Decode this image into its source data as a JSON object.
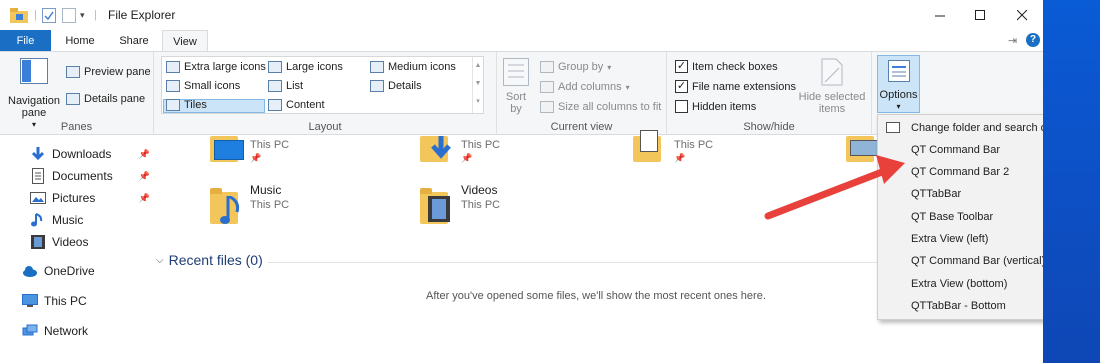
{
  "window": {
    "title": "File Explorer"
  },
  "tabs": [
    {
      "label": "File"
    },
    {
      "label": "Home"
    },
    {
      "label": "Share"
    },
    {
      "label": "View"
    }
  ],
  "ribbon": {
    "panes": {
      "label": "Panes",
      "navigation_pane": "Navigation pane",
      "preview_pane": "Preview pane",
      "details_pane": "Details pane"
    },
    "layout": {
      "label": "Layout",
      "options": [
        {
          "label": "Extra large icons"
        },
        {
          "label": "Large icons"
        },
        {
          "label": "Medium icons"
        },
        {
          "label": "Small icons"
        },
        {
          "label": "List"
        },
        {
          "label": "Details"
        },
        {
          "label": "Tiles",
          "selected": true
        },
        {
          "label": "Content"
        }
      ]
    },
    "current_view": {
      "label": "Current view",
      "sort_by": "Sort by",
      "group_by": "Group by",
      "add_columns": "Add columns",
      "size_all_columns": "Size all columns to fit"
    },
    "show_hide": {
      "label": "Show/hide",
      "item_check_boxes": {
        "label": "Item check boxes",
        "checked": true
      },
      "file_name_extensions": {
        "label": "File name extensions",
        "checked": true
      },
      "hidden_items": {
        "label": "Hidden items",
        "checked": false
      },
      "hide_selected_items": "Hide selected items"
    },
    "options": {
      "label": "Options"
    }
  },
  "nav": {
    "items": [
      {
        "label": "Downloads",
        "icon": "download-arrow-icon",
        "pinned": true
      },
      {
        "label": "Documents",
        "icon": "document-icon",
        "pinned": true
      },
      {
        "label": "Pictures",
        "icon": "picture-icon",
        "pinned": true
      },
      {
        "label": "Music",
        "icon": "music-note-icon",
        "pinned": false
      },
      {
        "label": "Videos",
        "icon": "video-icon",
        "pinned": false
      },
      {
        "label": "OneDrive",
        "icon": "cloud-icon",
        "pinned": false
      },
      {
        "label": "This PC",
        "icon": "monitor-icon",
        "pinned": false
      },
      {
        "label": "Network",
        "icon": "network-icon",
        "pinned": false
      }
    ]
  },
  "content": {
    "folders": [
      {
        "name": "",
        "location": "This PC",
        "overlay": "desktop"
      },
      {
        "name": "",
        "location": "This PC",
        "overlay": "download"
      },
      {
        "name": "",
        "location": "This PC",
        "overlay": "document"
      },
      {
        "name": "",
        "location": "",
        "overlay": "picture"
      },
      {
        "name": "Music",
        "location": "This PC",
        "overlay": "music"
      },
      {
        "name": "Videos",
        "location": "This PC",
        "overlay": "video"
      }
    ],
    "recent_files_header": "Recent files (0)",
    "recent_empty_message": "After you've opened some files, we'll show the most recent ones here."
  },
  "options_menu": {
    "items": [
      {
        "label": "Change folder and search options",
        "icon": "options-icon"
      },
      {
        "label": "QT Command Bar"
      },
      {
        "label": "QT Command Bar 2"
      },
      {
        "label": "QTTabBar"
      },
      {
        "label": "QT Base Toolbar"
      },
      {
        "label": "Extra View (left)"
      },
      {
        "label": "QT Command Bar (vertical)"
      },
      {
        "label": "Extra View (bottom)"
      },
      {
        "label": "QTTabBar - Bottom"
      }
    ]
  },
  "annotation": {
    "type": "arrow",
    "color": "#e8413b"
  }
}
